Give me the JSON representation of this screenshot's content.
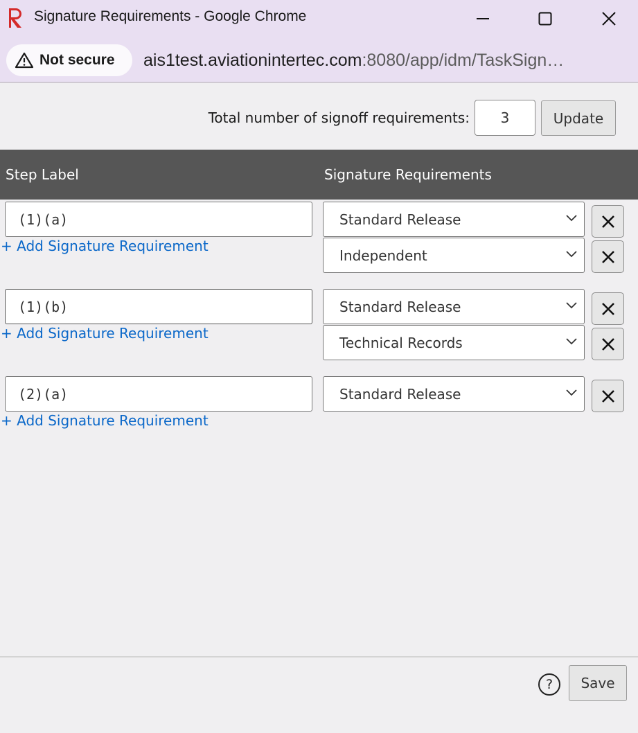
{
  "window": {
    "title": "Signature Requirements - Google Chrome",
    "logo_icon": "r-logo-icon",
    "controls": [
      "minimize-icon",
      "maximize-icon",
      "close-icon"
    ]
  },
  "address_bar": {
    "security_label": "Not secure",
    "security_icon": "warning-triangle-icon",
    "url_host": "ais1test.aviationintertec.com",
    "url_rest": ":8080/app/idm/TaskSign…"
  },
  "toolbar": {
    "total_label": "Total number of signoff requirements:",
    "total_value": "3",
    "update_label": "Update"
  },
  "table": {
    "headers": {
      "step_label": "Step Label",
      "signature_requirements": "Signature Requirements"
    },
    "add_link_label": "+ Add Signature Requirement",
    "rows": [
      {
        "step": "(1)(a)",
        "requirements": [
          "Standard Release",
          "Independent"
        ]
      },
      {
        "step": "(1)(b)",
        "requirements": [
          "Standard Release",
          "Technical Records"
        ]
      },
      {
        "step": "(2)(a)",
        "requirements": [
          "Standard Release"
        ]
      }
    ]
  },
  "footer": {
    "help_icon": "help-circle-icon",
    "help_glyph": "?",
    "save_label": "Save"
  },
  "colors": {
    "titlebar": "#e9dff2",
    "header_bg": "#565656",
    "link": "#0b68c9",
    "logo": "#d42a2a"
  }
}
